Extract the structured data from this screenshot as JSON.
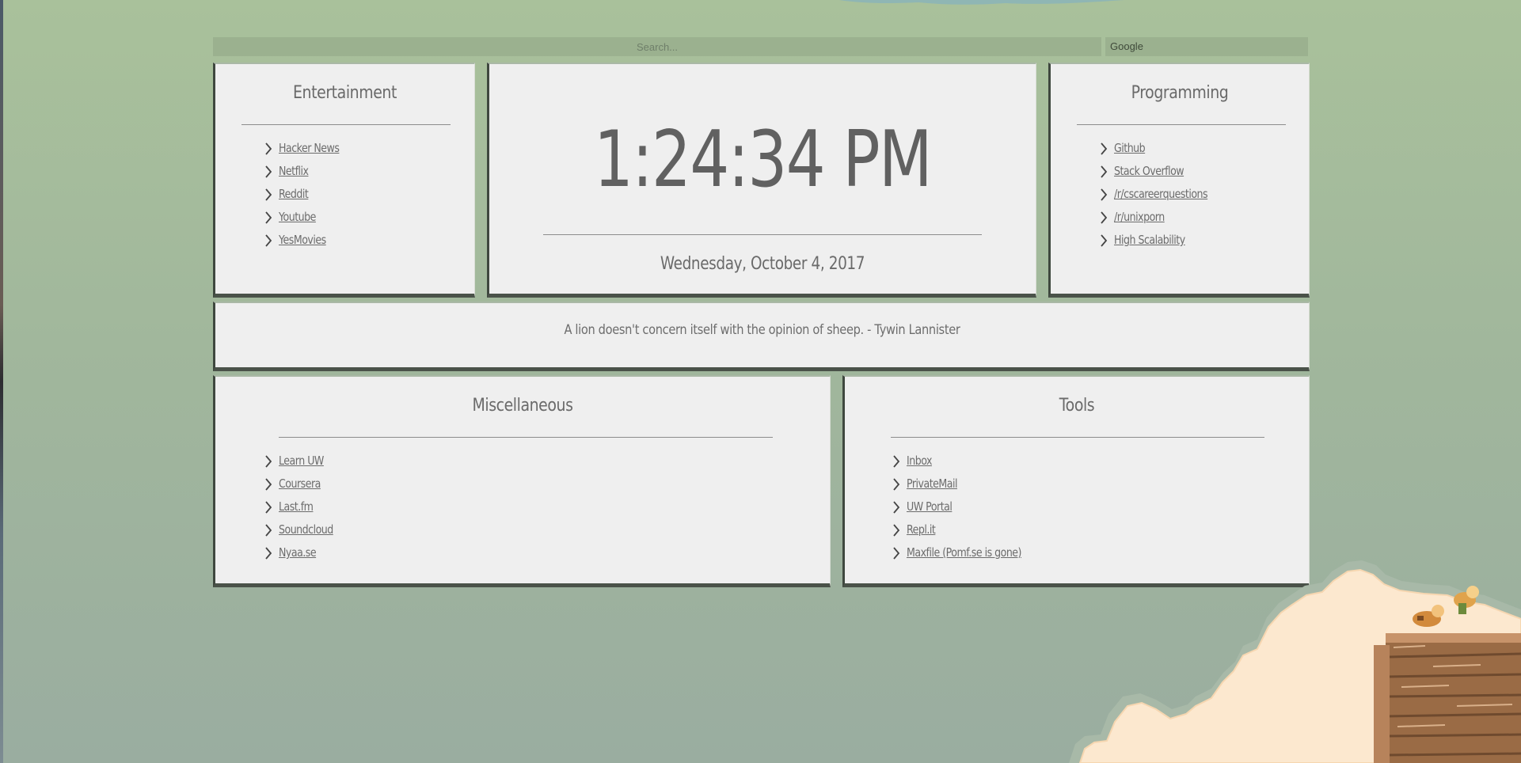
{
  "search": {
    "placeholder": "Search...",
    "engine": "Google"
  },
  "clock": {
    "time": "1:24:34 PM",
    "date": "Wednesday, October 4, 2017"
  },
  "quote": "A lion doesn't concern itself with the opinion of sheep. - Tywin Lannister",
  "sections": {
    "entertainment": {
      "title": "Entertainment",
      "links": [
        "Hacker News",
        "Netflix",
        "Reddit",
        "Youtube",
        "YesMovies"
      ]
    },
    "programming": {
      "title": "Programming",
      "links": [
        "Github",
        "Stack Overflow",
        "/r/cscareerquestions",
        "/r/unixporn",
        "High Scalability"
      ]
    },
    "miscellaneous": {
      "title": "Miscellaneous",
      "links": [
        "Learn UW",
        "Coursera",
        "Last.fm",
        "Soundcloud",
        "Nyaa.se"
      ]
    },
    "tools": {
      "title": "Tools",
      "links": [
        "Inbox",
        "PrivateMail",
        "UW Portal",
        "Repl.it",
        "Maxfile (Pomf.se is gone)"
      ]
    }
  },
  "colors": {
    "background": "#a1b79c",
    "card": "#efefef",
    "card_shadow": "#4a5249",
    "search_bar": "#9bb18f",
    "text": "#6a6a6a"
  },
  "icons": {
    "link_bullet": "chevron-right-icon"
  }
}
